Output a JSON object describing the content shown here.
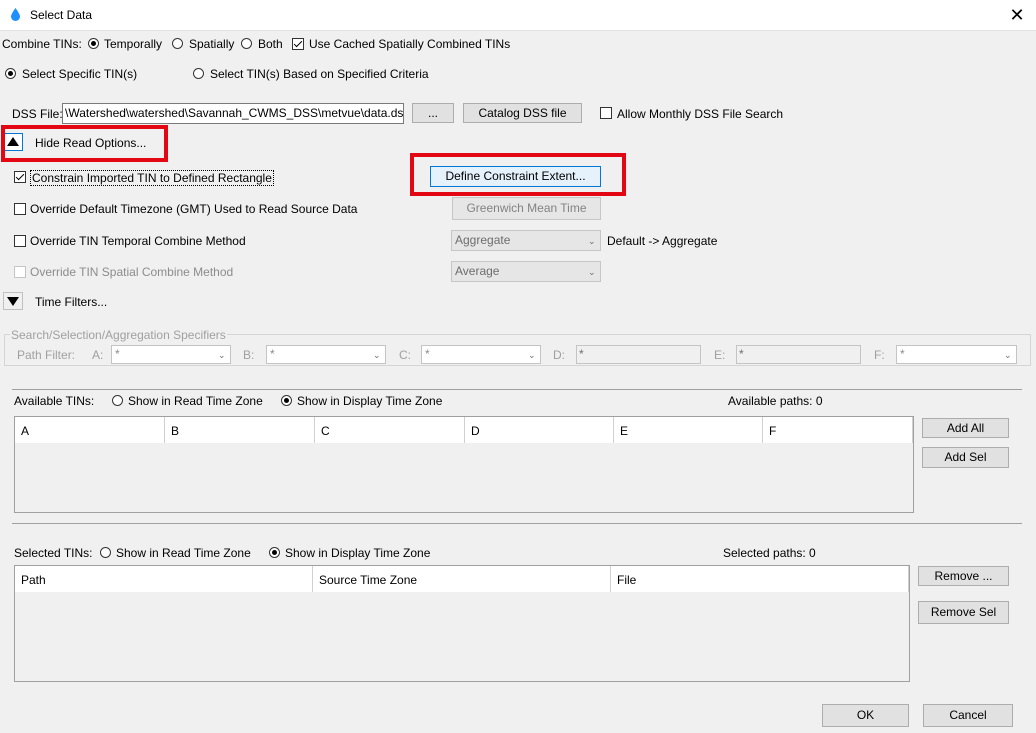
{
  "window": {
    "title": "Select Data",
    "close": "✕"
  },
  "combine": {
    "label": "Combine TINs:",
    "opt_temporally": "Temporally",
    "opt_spatially": "Spatially",
    "opt_both": "Both",
    "use_cached": "Use Cached Spatially Combined TINs"
  },
  "select_mode": {
    "specific": "Select Specific TIN(s)",
    "criteria": "Select TIN(s) Based on Specified Criteria"
  },
  "dss": {
    "label": "DSS File:",
    "path": "\\Watershed\\watershed\\Savannah_CWMS_DSS\\metvue\\data.dss",
    "browse": "...",
    "catalog": "Catalog DSS file",
    "allow_monthly": "Allow Monthly DSS File Search"
  },
  "read_options": {
    "toggle_label": "Hide Read Options...",
    "constrain": "Constrain Imported TIN to Defined Rectangle",
    "define_extent": "Define Constraint Extent...",
    "override_tz": "Override Default Timezone (GMT) Used to Read Source Data",
    "tz_value": "Greenwich Mean Time",
    "override_temporal": "Override TIN Temporal Combine Method",
    "temporal_value": "Aggregate",
    "temporal_default": "Default -> Aggregate",
    "override_spatial": "Override TIN Spatial Combine Method",
    "spatial_value": "Average"
  },
  "time_filters": {
    "label": "Time Filters..."
  },
  "specifiers": {
    "group_title": "Search/Selection/Aggregation Specifiers",
    "path_filter": "Path Filter:",
    "a_label": "A:",
    "a_value": "*",
    "b_label": "B:",
    "b_value": "*",
    "c_label": "C:",
    "c_value": "*",
    "d_label": "D:",
    "d_value": "*",
    "e_label": "E:",
    "e_value": "*",
    "f_label": "F:",
    "f_value": "*"
  },
  "available": {
    "label": "Available TINs:",
    "read_tz": "Show in Read Time Zone",
    "display_tz": "Show in Display Time Zone",
    "count": "Available paths: 0",
    "columns": [
      "A",
      "B",
      "C",
      "D",
      "E",
      "F"
    ],
    "add_all": "Add All",
    "add_sel": "Add Sel"
  },
  "selected": {
    "label": "Selected TINs:",
    "read_tz": "Show in Read Time Zone",
    "display_tz": "Show in Display Time Zone",
    "count": "Selected paths: 0",
    "columns": [
      "Path",
      "Source Time Zone",
      "File"
    ],
    "remove": "Remove ...",
    "remove_sel": "Remove Sel"
  },
  "footer": {
    "ok": "OK",
    "cancel": "Cancel"
  },
  "colors": {
    "highlight_box": "#e30613",
    "focus_border": "#0078d7",
    "title_icon": "#1e90ff"
  }
}
